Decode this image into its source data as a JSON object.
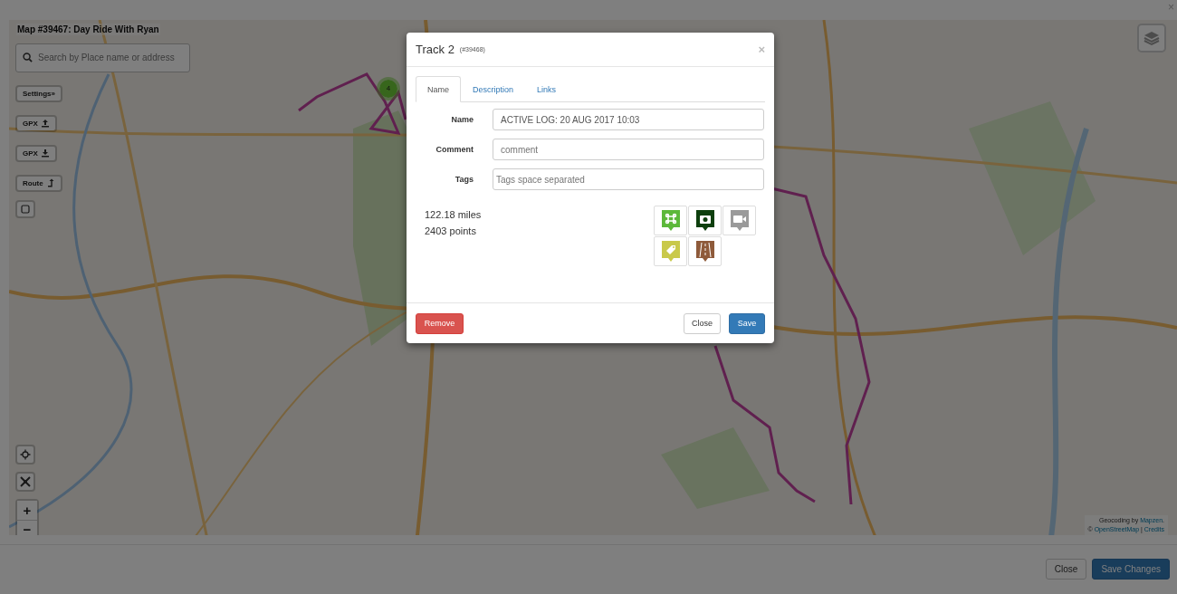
{
  "page": {
    "close": "×"
  },
  "map": {
    "title": "Map #39467: Day Ride With Ryan",
    "search": {
      "placeholder": "Search by Place name or address"
    },
    "controls": [
      {
        "kind": "settings",
        "label": "Settings",
        "glyph": "»"
      },
      {
        "kind": "upload",
        "label": "GPX"
      },
      {
        "kind": "download",
        "label": "GPX"
      },
      {
        "kind": "route",
        "label": "Route"
      },
      {
        "kind": "square"
      }
    ],
    "cluster": {
      "count": "4"
    },
    "zoom": {
      "in": "+",
      "out": "−"
    },
    "geocoding": {
      "before": "Geocoding by",
      "link": "Mapzen",
      "after": "."
    },
    "copyright": {
      "prefix": "©",
      "osm": "OpenStreetMap",
      "sep": "|",
      "credits": "Credits"
    }
  },
  "modal": {
    "title": "Track 2",
    "id": "(#39468)",
    "close": "×",
    "tabs": [
      {
        "label": "Name",
        "selected": true
      },
      {
        "label": "Description",
        "selected": false
      },
      {
        "label": "Links",
        "selected": false
      }
    ],
    "fields": [
      {
        "label": "Name",
        "value": "ACTIVE LOG: 20 AUG 2017 10:03"
      },
      {
        "label": "Comment",
        "placeholder": "comment"
      },
      {
        "label": "Tags",
        "placeholder": "Tags space separated"
      }
    ],
    "stats": [
      "122.18 miles",
      "2403 points"
    ],
    "icons": [
      {
        "kind": "command",
        "color": "#5cb83a"
      },
      {
        "kind": "camera",
        "color": "#0d3f0d"
      },
      {
        "kind": "video",
        "color": "#9a9a9a"
      },
      {
        "kind": "tag",
        "color": "#c9c94a"
      },
      {
        "kind": "road",
        "color": "#8e5a3a"
      }
    ],
    "buttons": {
      "remove": "Remove",
      "close": "Close",
      "save": "Save"
    }
  },
  "footer": {
    "buttons": [
      {
        "label": "Close",
        "kind": "default"
      },
      {
        "label": "Save Changes",
        "kind": "primary"
      }
    ]
  }
}
